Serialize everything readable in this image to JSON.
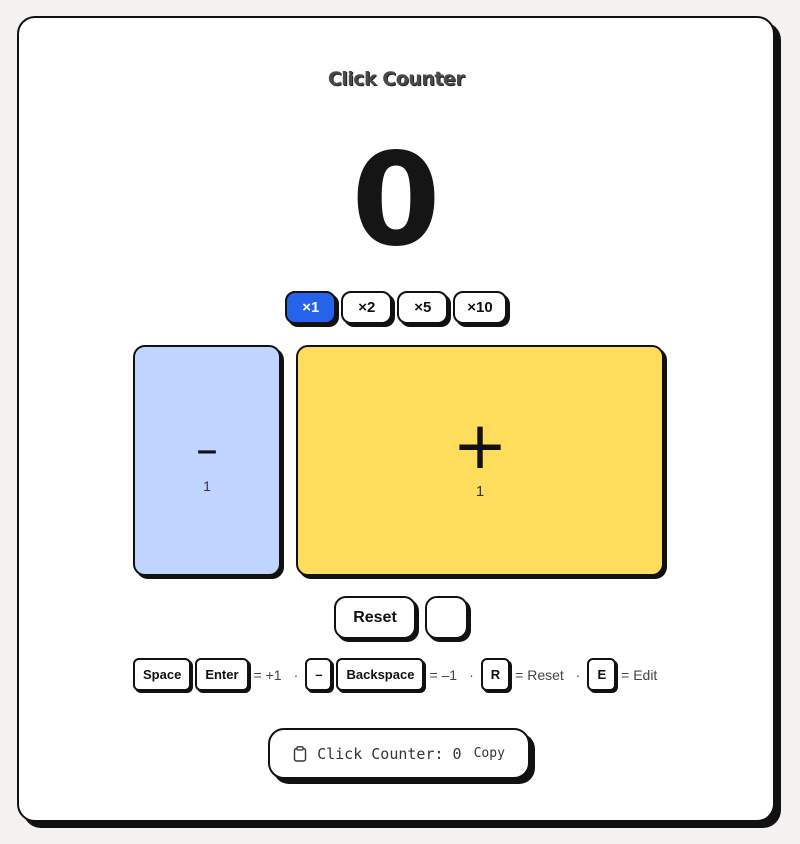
{
  "app": {
    "title": "Click Counter"
  },
  "counter": {
    "value": "0"
  },
  "multipliers": [
    {
      "label": "×1",
      "active": true
    },
    {
      "label": "×2",
      "active": false
    },
    {
      "label": "×5",
      "active": false
    },
    {
      "label": "×10",
      "active": false
    }
  ],
  "pads": {
    "minus": {
      "symbol": "–",
      "step": "1",
      "color": "#bfd5ff"
    },
    "plus": {
      "symbol": "+",
      "step": "1",
      "color": "#ffdd5c"
    }
  },
  "actions": {
    "reset_label": "Reset",
    "edit_label": ""
  },
  "shortcuts": {
    "key_space": "Space",
    "key_enter": "Enter",
    "inc_text": "= +1",
    "key_minus": "–",
    "key_backspace": "Backspace",
    "dec_text": "= –1",
    "key_r": "R",
    "reset_text": "= Reset",
    "key_e": "E",
    "edit_text": "= Edit",
    "separator": "·"
  },
  "copy_bar": {
    "text": "Click Counter: 0",
    "copy_label": "Copy",
    "icon": "clipboard-icon"
  },
  "colors": {
    "accent": "#2563eb",
    "minus_pad": "#bfd5ff",
    "plus_pad": "#ffdd5c"
  }
}
